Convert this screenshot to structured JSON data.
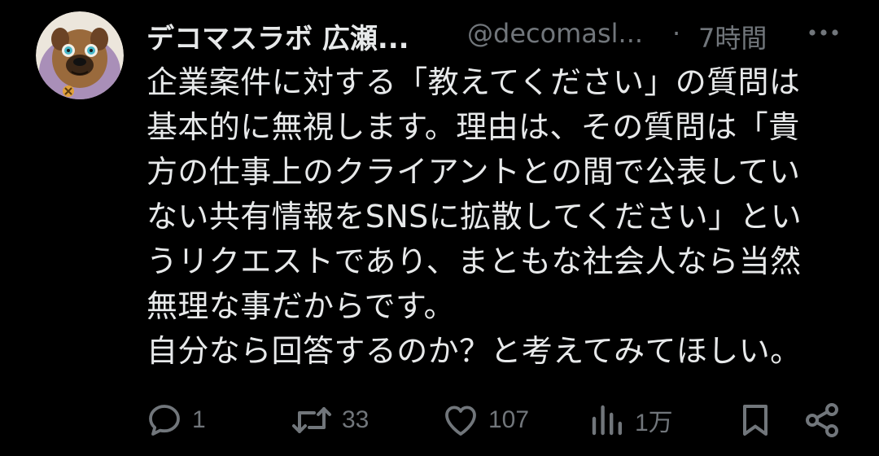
{
  "tweet": {
    "display_name": "デコマスラボ 広瀬...",
    "handle": "@decomasl...",
    "separator": "·",
    "timestamp": "7時間",
    "more_label": "•••",
    "body_lines": [
      "企業案件に対する「教えてください」の質問は",
      "基本的に無視します。理由は、その質問は「貴",
      "方の仕事上のクライアントとの間で公表してい",
      "ない共有情報をSNSに拡散してください」とい",
      "うリクエストであり、まともな社会人なら当然",
      "無理な事だからです。",
      "自分なら回答するのか？と考えてみてほしい。"
    ]
  },
  "actions": {
    "reply": {
      "icon": "reply-icon",
      "count": "1"
    },
    "repost": {
      "icon": "repost-icon",
      "count": "33"
    },
    "like": {
      "icon": "heart-icon",
      "count": "107"
    },
    "views": {
      "icon": "views-icon",
      "count": "1万"
    },
    "bookmark": {
      "icon": "bookmark-icon"
    },
    "share": {
      "icon": "share-icon"
    }
  },
  "colors": {
    "background": "#000000",
    "primary_text": "#e7e9ea",
    "secondary_text": "#71767b"
  }
}
